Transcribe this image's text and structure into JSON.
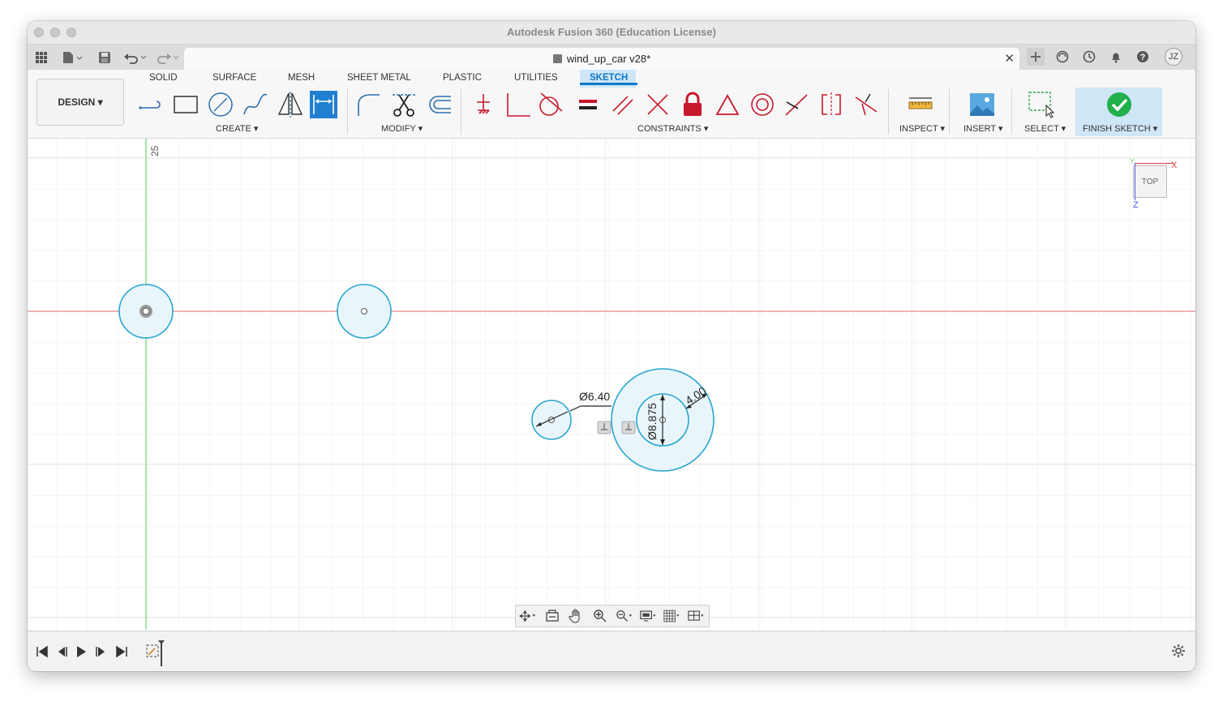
{
  "window": {
    "title": "Autodesk Fusion 360 (Education License)"
  },
  "document_tab": {
    "title": "wind_up_car v28*",
    "close": "✕"
  },
  "user": {
    "initials": "JZ"
  },
  "design_menu": {
    "label": "DESIGN ▾"
  },
  "workspace_tabs": [
    "SOLID",
    "SURFACE",
    "MESH",
    "SHEET METAL",
    "PLASTIC",
    "UTILITIES",
    "SKETCH"
  ],
  "active_tab": "SKETCH",
  "groups": {
    "create": "CREATE ▾",
    "modify": "MODIFY ▾",
    "constraints": "CONSTRAINTS ▾",
    "inspect": "INSPECT ▾",
    "insert": "INSERT ▾",
    "select": "SELECT ▾",
    "finish": "FINISH SKETCH ▾"
  },
  "canvas": {
    "axis_label": "25",
    "dimensions": {
      "small_diameter": "Ø6.40",
      "large_diameter": "Ø8.875",
      "offset": "4.00"
    }
  },
  "viewcube": {
    "face": "TOP",
    "x_axis": "X",
    "z_axis": "Z",
    "y_axis": "Y"
  },
  "colors": {
    "accent": "#0d79c8",
    "sketch_blue": "#2aa6cf",
    "fill": "#e8f6fc",
    "x_axis": "#e88a8a",
    "y_axis": "#6cd46c",
    "constraint_red": "#c8182b",
    "finish_green": "#21b04b"
  }
}
